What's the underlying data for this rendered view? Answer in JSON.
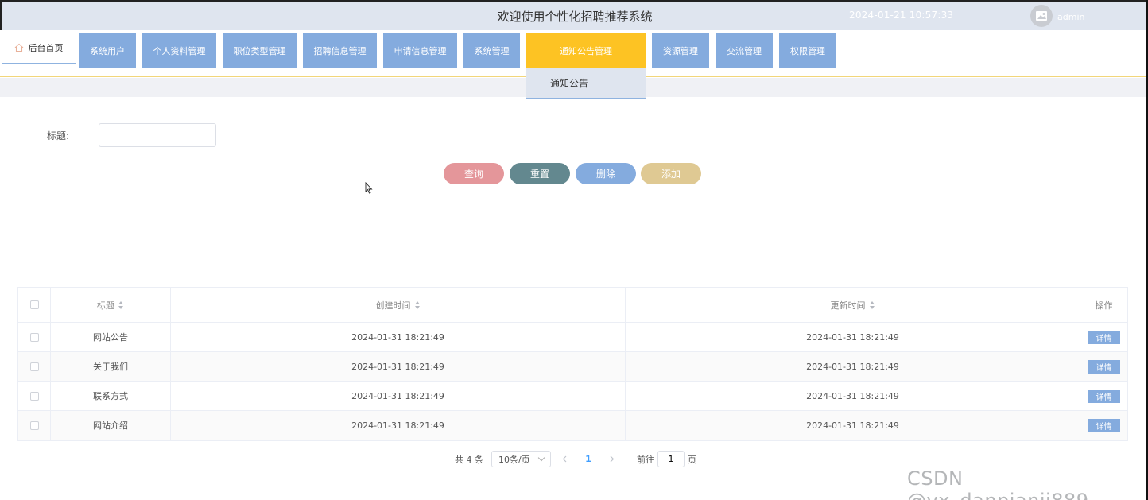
{
  "header": {
    "title": "欢迎使用个性化招聘推荐系统",
    "datetime": "2024-01-21 10:57:33",
    "username": "admin"
  },
  "nav": {
    "home": "后台首页",
    "items": [
      {
        "label": "系统用户"
      },
      {
        "label": "个人资料管理"
      },
      {
        "label": "职位类型管理"
      },
      {
        "label": "招聘信息管理"
      },
      {
        "label": "申请信息管理"
      },
      {
        "label": "系统管理"
      },
      {
        "label": "通知公告管理"
      },
      {
        "label": "资源管理"
      },
      {
        "label": "交流管理"
      },
      {
        "label": "权限管理"
      }
    ],
    "active_index": 6,
    "active_color": "#fdc323",
    "item_color": "#84abde",
    "dropdown_item": "通知公告"
  },
  "search": {
    "label": "标题:",
    "value": "",
    "placeholder": ""
  },
  "buttons": {
    "query": "查询",
    "reset": "重置",
    "delete": "删除",
    "add": "添加",
    "colors": {
      "query": "#e4969a",
      "reset": "#63888f",
      "delete": "#84abde",
      "add": "#dfc993"
    }
  },
  "table": {
    "columns": [
      "标题",
      "创建时间",
      "更新时间",
      "操作"
    ],
    "rows": [
      {
        "title": "网站公告",
        "created": "2024-01-31 18:21:49",
        "updated": "2024-01-31 18:21:49",
        "action": "详情"
      },
      {
        "title": "关于我们",
        "created": "2024-01-31 18:21:49",
        "updated": "2024-01-31 18:21:49",
        "action": "详情"
      },
      {
        "title": "联系方式",
        "created": "2024-01-31 18:21:49",
        "updated": "2024-01-31 18:21:49",
        "action": "详情"
      },
      {
        "title": "网站介绍",
        "created": "2024-01-31 18:21:49",
        "updated": "2024-01-31 18:21:49",
        "action": "详情"
      }
    ]
  },
  "pagination": {
    "total": "共 4 条",
    "page_size": "10条/页",
    "current_page": "1",
    "goto_label": "前往",
    "goto_value": "1",
    "page_suffix": "页"
  },
  "watermark": "CSDN @vx_danpianji889"
}
